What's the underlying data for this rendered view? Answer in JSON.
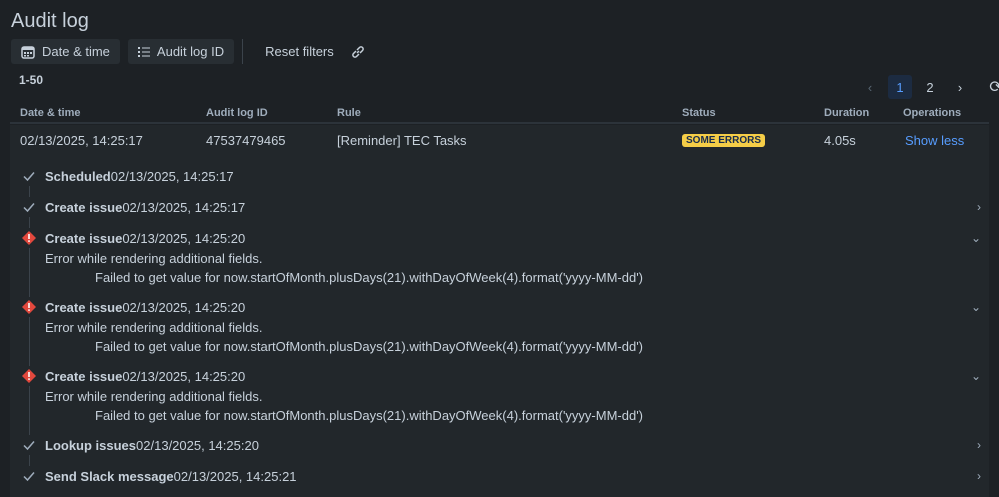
{
  "title": "Audit log",
  "toolbar": {
    "date_time": "Date & time",
    "audit_id": "Audit log ID",
    "reset": "Reset filters"
  },
  "count": "1-50",
  "pager": {
    "pages": [
      "1",
      "2"
    ],
    "active": "1"
  },
  "columns": [
    "Date & time",
    "Audit log ID",
    "Rule",
    "Status",
    "Duration",
    "Operations"
  ],
  "row": {
    "date": "02/13/2025, 14:25:17",
    "id": "47537479465",
    "rule": "[Reminder] TEC Tasks",
    "status": "SOME ERRORS",
    "duration": "4.05s",
    "operation": "Show less"
  },
  "steps": [
    {
      "status": "success",
      "name": "Scheduled",
      "time": "02/13/2025, 14:25:17"
    },
    {
      "status": "success",
      "name": "Create issue",
      "time": "02/13/2025, 14:25:17",
      "chevron": "right"
    },
    {
      "status": "error",
      "name": "Create issue",
      "time": "02/13/2025, 14:25:20",
      "chevron": "down",
      "message": "Error while rendering additional fields.",
      "detail": "Failed to get value for now.startOfMonth.plusDays(21).withDayOfWeek(4).format('yyyy-MM-dd')"
    },
    {
      "status": "error",
      "name": "Create issue",
      "time": "02/13/2025, 14:25:20",
      "chevron": "down",
      "message": "Error while rendering additional fields.",
      "detail": "Failed to get value for now.startOfMonth.plusDays(21).withDayOfWeek(4).format('yyyy-MM-dd')"
    },
    {
      "status": "error",
      "name": "Create issue",
      "time": "02/13/2025, 14:25:20",
      "chevron": "down",
      "message": "Error while rendering additional fields.",
      "detail": "Failed to get value for now.startOfMonth.plusDays(21).withDayOfWeek(4).format('yyyy-MM-dd')"
    },
    {
      "status": "success",
      "name": "Lookup issues",
      "time": "02/13/2025, 14:25:20",
      "chevron": "right"
    },
    {
      "status": "success",
      "name": "Send Slack message",
      "time": "02/13/2025, 14:25:21",
      "chevron": "right"
    }
  ],
  "colors": {
    "error": "#e2483d",
    "badge": "#f5cd47",
    "link": "#579dff"
  }
}
